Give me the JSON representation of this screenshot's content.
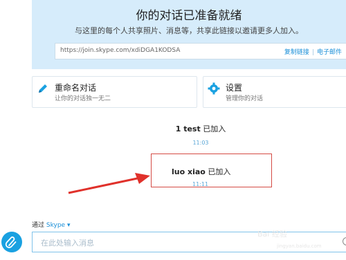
{
  "banner": {
    "title": "你的对话已准备就绪",
    "subtitle": "与这里的每个人共享照片、消息等，共享此链接以邀请更多人加入。",
    "link_url": "https://join.skype.com/xdiDGA1KODSA",
    "copy_link": "复制链接",
    "email": "电子邮件"
  },
  "cards": {
    "rename": {
      "title": "重命名对话",
      "desc": "让你的对话独一无二",
      "icon": "pencil-icon"
    },
    "settings": {
      "title": "设置",
      "desc": "管理你的对话",
      "icon": "gear-icon"
    }
  },
  "messages": [
    {
      "user": "1 test",
      "action": "已加入",
      "time": "11:03"
    },
    {
      "user": "luo xiao",
      "action": "已加入",
      "time": "11:11"
    }
  ],
  "composer": {
    "via_label": "通过",
    "network": "Skype",
    "placeholder": "在此处输入消息"
  },
  "watermark": {
    "text": "Bai 经验",
    "url": "jingyan.baidu.com"
  },
  "colors": {
    "banner_bg": "#d6ecfb",
    "accent": "#1a8fd8",
    "highlight": "#d44a44"
  }
}
